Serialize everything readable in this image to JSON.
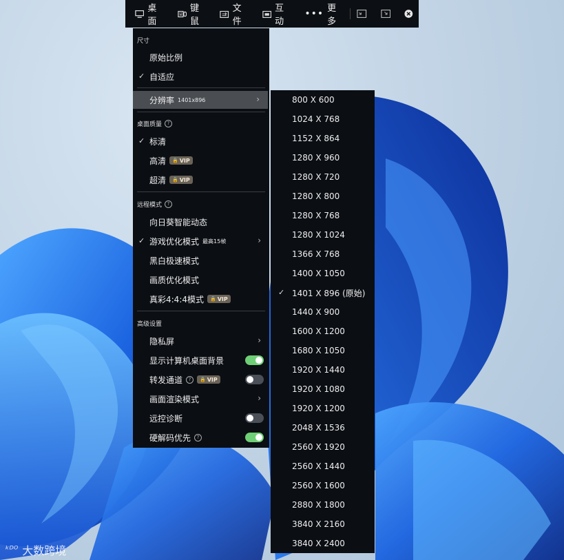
{
  "toolbar": {
    "desktop": "桌面",
    "keyboard_mouse": "键鼠",
    "file": "文件",
    "interact": "互动",
    "more": "更多"
  },
  "menu": {
    "size_section": "尺寸",
    "original_ratio": "原始比例",
    "adaptive": "自适应",
    "resolution_label": "分辨率",
    "resolution_value": "1401x896",
    "quality_section": "桌面质量",
    "quality_std": "标清",
    "quality_high": "高清",
    "quality_ultra": "超清",
    "vip": "VIP",
    "remote_section": "远程模式",
    "mode_smart": "向日葵智能动态",
    "mode_game": "游戏优化模式",
    "mode_game_sub": "最高15帧",
    "mode_bw": "黑白极速模式",
    "mode_quality": "画质优化模式",
    "mode_truecolor": "真彩4:4:4模式",
    "advanced_section": "高级设置",
    "privacy": "隐私屏",
    "show_bg": "显示计算机桌面背景",
    "forward_channel": "转发通道",
    "render_mode": "画面渲染模式",
    "remote_diag": "远控诊断",
    "hw_decode": "硬解码优先"
  },
  "toggles": {
    "show_bg": true,
    "forward_channel": false,
    "remote_diag": false,
    "hw_decode": true
  },
  "resolutions": [
    "800 X 600",
    "1024 X 768",
    "1152 X 864",
    "1280 X 960",
    "1280 X 720",
    "1280 X 800",
    "1280 X 768",
    "1280 X 1024",
    "1366 X 768",
    "1400 X 1050",
    "1401 X 896 (原始)",
    "1440 X 900",
    "1600 X 1200",
    "1680 X 1050",
    "1920 X 1440",
    "1920 X 1080",
    "1920 X 1200",
    "2048 X 1536",
    "2560 X 1920",
    "2560 X 1440",
    "2560 X 1600",
    "2880 X 1800",
    "3840 X 2160",
    "3840 X 2400"
  ],
  "selected_resolution": "1401 X 896 (原始)",
  "watermark": "大数跨境",
  "colors": {
    "accent_green": "#6fcf76",
    "menu_bg": "#0b0e13",
    "highlight": "#4a4d52"
  }
}
